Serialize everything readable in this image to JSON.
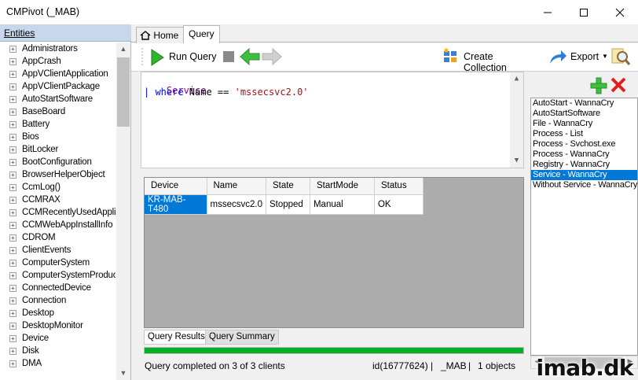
{
  "window": {
    "title": "CMPivot (_MAB)"
  },
  "entities": {
    "header": "Entities",
    "items": [
      "Administrators",
      "AppCrash",
      "AppVClientApplication",
      "AppVClientPackage",
      "AutoStartSoftware",
      "BaseBoard",
      "Battery",
      "Bios",
      "BitLocker",
      "BootConfiguration",
      "BrowserHelperObject",
      "CcmLog()",
      "CCMRAX",
      "CCMRecentlyUsedApplic",
      "CCMWebAppInstallInfo",
      "CDROM",
      "ClientEvents",
      "ComputerSystem",
      "ComputerSystemProduct",
      "ConnectedDevice",
      "Connection",
      "Desktop",
      "DesktopMonitor",
      "Device",
      "Disk",
      "DMA"
    ]
  },
  "tabs": {
    "home": "Home",
    "query": "Query"
  },
  "toolbar": {
    "run_query": "Run Query",
    "create_collection": "Create Collection",
    "export": "Export"
  },
  "editor": {
    "line1": "Service",
    "line2_pipe": "| ",
    "line2_kw": "where",
    "line2_rest": " Name == ",
    "line2_str": "'mssecsvc2.0'"
  },
  "results": {
    "columns": [
      "Device",
      "Name",
      "State",
      "StartMode",
      "Status"
    ],
    "rows": [
      [
        "KR-MAB-T480",
        "mssecsvc2.0",
        "Stopped",
        "Manual",
        "OK"
      ]
    ]
  },
  "subtabs": {
    "query_results": "Query Results",
    "query_summary": "Query Summary"
  },
  "progress": {
    "fraction": 1.0
  },
  "status": {
    "message": "Query completed on 3 of 3 clients",
    "id": "id(16777624)",
    "site": "_MAB",
    "objects": "1 objects",
    "sep1": "|",
    "sep2": "|"
  },
  "saved_queries": {
    "items": [
      "AutoStart - WannaCry",
      "AutoStartSoftware",
      "File - WannaCry",
      "Process - List",
      "Process - Svchost.exe",
      "Process - WannaCry",
      "Registry - WannaCry",
      "Service - WannaCry",
      "Without Service - WannaCry"
    ],
    "selected_index": 7
  },
  "watermark": "imab.dk",
  "colors": {
    "accent": "#0078d7",
    "progress": "#06b025",
    "keyword": "#0000ff",
    "string": "#a31515",
    "entity": "#8b008b"
  }
}
